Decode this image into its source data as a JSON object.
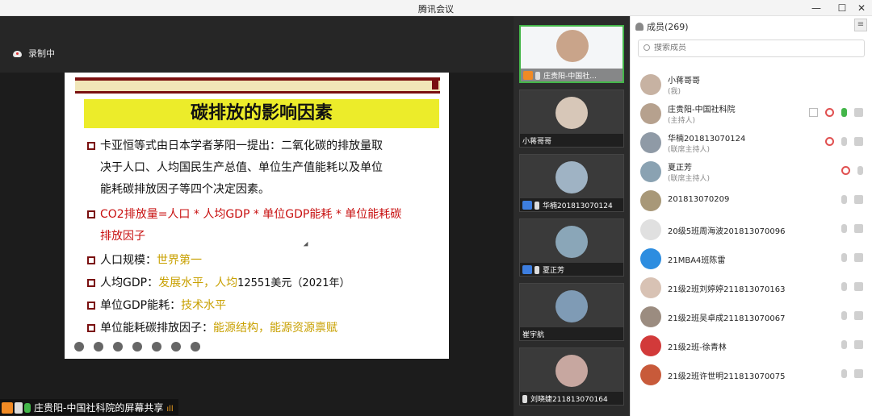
{
  "window": {
    "title": "腾讯会议",
    "min": "—",
    "max": "☐",
    "close": "✕"
  },
  "stage": {
    "recording_label": "录制中",
    "share_label": "庄贵阳-中国社科院的屏幕共享",
    "signal": "ıll"
  },
  "slide": {
    "title": "碳排放的影响因素",
    "bullets": [
      {
        "text": "卡亚恒等式由日本学者茅阳一提出：二氧化碳的排放量取",
        "cont1": "决于人口、人均国民生产总值、单位生产值能耗以及单位",
        "cont2": "能耗碳排放因子等四个决定因素。"
      },
      {
        "text": "CO2排放量=人口 * 人均GDP * 单位GDP能耗 * 单位能耗碳",
        "cont1": "排放因子"
      },
      {
        "label": "人口规模：",
        "value": "世界第一"
      },
      {
        "label": "人均GDP：",
        "value": "发展水平，人均",
        "tail": "12551美元（2021年）"
      },
      {
        "label": "单位GDP能耗：",
        "value": "技术水平"
      },
      {
        "label": "单位能耗碳排放因子：",
        "value": "能源结构，能源资源禀赋"
      }
    ]
  },
  "video_tiles": [
    {
      "name": "庄贵阳-中国社...",
      "active": true
    },
    {
      "name": "小蒋哥哥"
    },
    {
      "name": "华楠201813070124"
    },
    {
      "name": "夏正芳"
    },
    {
      "name": "崔宇航"
    },
    {
      "name": "刘晓婕211813070164"
    }
  ],
  "panel": {
    "title": "成员(269)",
    "menu": "≡",
    "search_placeholder": "搜索成员",
    "members": [
      {
        "name": "小蒋哥哥",
        "role": "(我)"
      },
      {
        "name": "庄贵阳-中国社科院",
        "role": "(主持人)"
      },
      {
        "name": "华楠201813070124",
        "role": "(联席主持人)"
      },
      {
        "name": "夏正芳",
        "role": "(联席主持人)"
      },
      {
        "name": "201813070209"
      },
      {
        "name": "20级5班周海波201813070096"
      },
      {
        "name": "21MBA4班陈雷"
      },
      {
        "name": "21级2班刘婷婷211813070163"
      },
      {
        "name": "21级2班吴卓成211813070067"
      },
      {
        "name": "21级2班-徐青林"
      },
      {
        "name": "21级2班许世明211813070075"
      }
    ]
  }
}
